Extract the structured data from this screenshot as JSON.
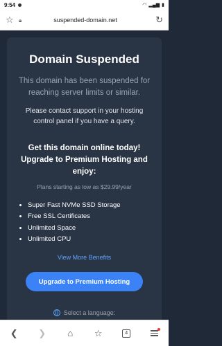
{
  "statusbar": {
    "time": "9:54"
  },
  "browser": {
    "url": "suspended-domain.net",
    "tab_count": "4"
  },
  "card": {
    "title": "Domain Suspended",
    "subtitle": "This domain has been suspended for reaching server limits or similar.",
    "contact": "Please contact support in your hosting control panel if you have a query.",
    "upgrade_heading": "Get this domain online today! Upgrade to Premium Hosting and enjoy:",
    "plans_text": "Plans starting as low as $29.99/year",
    "benefits": [
      "Super Fast NVMe SSD Storage",
      "Free SSL Certificates",
      "Unlimited Space",
      "Unlimited CPU"
    ],
    "view_more": "View More Benefits",
    "cta_label": "Upgrade to Premium Hosting",
    "language_prompt": "Select a language:"
  },
  "colors": {
    "background": "#1f2937",
    "card": "#293444",
    "accent": "#3b82f6",
    "link": "#60a5fa"
  }
}
